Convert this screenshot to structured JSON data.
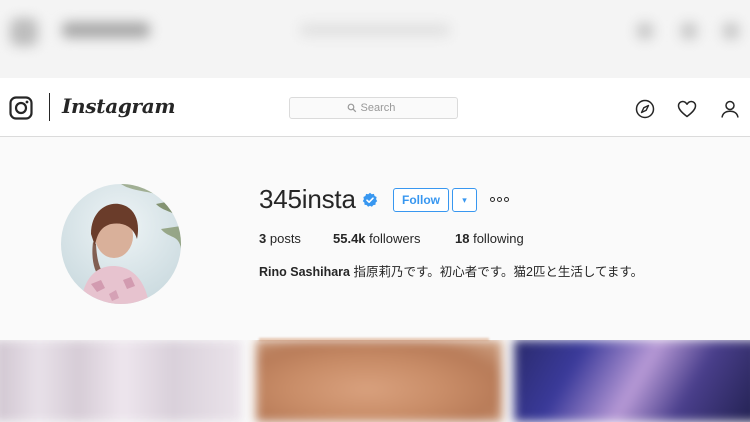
{
  "navbar": {
    "brand": "Instagram",
    "search_placeholder": "Search"
  },
  "profile": {
    "username": "345insta",
    "follow_label": "Follow",
    "caret": "▾",
    "stats": {
      "posts_count": "3",
      "posts_label": "posts",
      "followers_count": "55.4k",
      "followers_label": "followers",
      "following_count": "18",
      "following_label": "following"
    },
    "bio_name": "Rino Sashihara",
    "bio_text": "指原莉乃です。初心者です。猫2匹と生活してます。"
  },
  "icons": {
    "logo": "instagram-glyph-icon",
    "search": "search-icon",
    "explore": "compass-icon",
    "activity": "heart-icon",
    "profile": "person-icon",
    "verified": "verified-badge-icon",
    "more": "ellipsis-icon"
  },
  "colors": {
    "accent": "#3897f0",
    "text": "#262626",
    "background": "#fafafa",
    "border": "#dbdbdb"
  }
}
